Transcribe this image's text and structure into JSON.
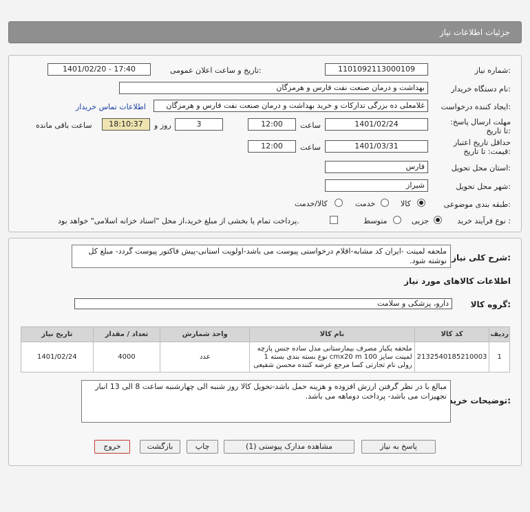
{
  "header": {
    "title": "جزئیات اطلاعات نیاز"
  },
  "fields": {
    "need_number_label": "شماره نیاز:",
    "need_number": "1101092113000109",
    "announce_label": "تاریخ و ساعت اعلان عمومی:",
    "announce_value": "1401/02/20 - 17:40",
    "buyer_org_label": "نام دستگاه خریدار:",
    "buyer_org": "بهداشت و درمان صنعت نفت فارس و هرمزگان",
    "creator_label": "ایجاد کننده درخواست:",
    "creator": "غلامعلی ده بزرگی تدارکات و خرید بهداشت و درمان صنعت نفت فارس و هرمزگان",
    "contact_link": "اطلاعات تماس خریدار",
    "reply_deadline_label": "مهلت ارسال پاسخ: تا تاریخ:",
    "reply_date": "1401/02/24",
    "time_label": "ساعت",
    "reply_time": "12:00",
    "days": "3",
    "days_label": "روز و",
    "remaining_time": "18:10:37",
    "remaining_label": "ساعت باقی مانده",
    "min_validity_label": "حداقل تاریخ اعتبار قیمت: تا تاریخ:",
    "validity_date": "1401/03/31",
    "validity_time": "12:00",
    "province_label": "استان محل تحویل:",
    "province": "فارس",
    "city_label": "شهر محل تحویل:",
    "city": "شیراز",
    "category_label": "طبقه بندی موضوعی:",
    "cat_options": [
      "کالا",
      "خدمت",
      "کالا/خدمت"
    ],
    "process_label": "نوع فرآیند خرید :",
    "process_options": [
      "جزیی",
      "متوسط"
    ],
    "payment_note": "پرداخت تمام یا بخشی از مبلغ خرید،از محل \"اسناد خزانه اسلامی\" خواهد بود."
  },
  "summary": {
    "label": "شرح کلی نیاز:",
    "text": "ملحفه لمینت  -ایران کد مشابه-اقلام درخواستی پیوست می باشد-اولویت استانی-پیش فاکتور پیوست گردد- مبلغ کل نوشته شود."
  },
  "goods": {
    "section_title": "اطلاعات کالاهای مورد نیاز",
    "group_label": "گروه کالا:",
    "group_value": "دارو، پزشکی و سلامت",
    "columns": [
      "ردیف",
      "کد کالا",
      "نام کالا",
      "واحد شمارش",
      "تعداد / مقدار",
      "تاریخ نیاز"
    ],
    "rows": [
      {
        "row": "1",
        "code": "2132540185210003",
        "name": "ملحفه یکبار مصرف بیمارستانی مدل ساده جنس پارچه لمینت سایز cmx20 m 100 نوع بسته بندی بسته 1 رولی نام تجارتی کسا مرجع عرضه کننده محسن شفیعی",
        "unit": "عدد",
        "qty": "4000",
        "date": "1401/02/24"
      }
    ]
  },
  "buyer_notes": {
    "label": "توضیحات خریدار:",
    "text": "مبالغ با در نظر گرفتن ارزش افزوده و هزینه حمل باشد-تحویل کالا روز شنبه الی چهارشنبه ساعت 8 الی 13 انبار تجهیزات می باشد- پرداخت دوماهه می باشد."
  },
  "buttons": {
    "reply": "پاسخ به نیاز",
    "view_docs": "مشاهده مدارک پیوستی (1)",
    "print": "چاپ",
    "back": "بازگشت",
    "exit": "خروج"
  },
  "colors": {
    "title_bg": "#8f8f8f",
    "exit_border": "#c0392b",
    "link": "#1a3ea6",
    "remaining_bg": "#efe3b0"
  }
}
